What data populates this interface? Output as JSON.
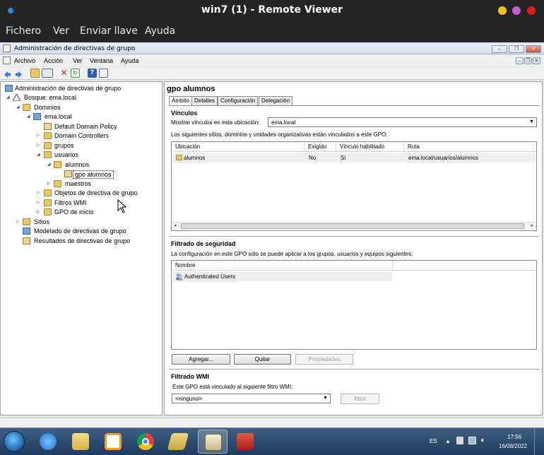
{
  "remote_viewer": {
    "title": "win7 (1) - Remote Viewer",
    "menu": [
      "Fichero",
      "Ver",
      "Enviar llave",
      "Ayuda"
    ],
    "window_controls": {
      "yellow": "#f5c211",
      "purple": "#c061cb",
      "red": "#e01b24"
    }
  },
  "gpmc": {
    "title": "Administración de directivas de grupo",
    "menu": [
      "Archivo",
      "Acción",
      "Ver",
      "Ventana",
      "Ayuda"
    ],
    "toolbar_icons": [
      "back-icon",
      "forward-icon",
      "folder-up-icon",
      "show-hide-tree-icon",
      "delete-icon",
      "refresh-icon",
      "help-icon",
      "properties-icon"
    ],
    "tree": {
      "root": "Administración de directivas de grupo",
      "forest": "Bosque: ema.local",
      "domains": "Dominios",
      "domain": "ema.local",
      "default_policy": "Default Domain Policy",
      "domain_controllers": "Domain Controllers",
      "grupos": "grupos",
      "usuarios": "usuarios",
      "alumnos": "alumnos",
      "gpo_alumnos": "gpo alumnos",
      "maestros": "maestros",
      "gpo_objects": "Objetos de directiva de grupo",
      "wmi_filters": "Filtros WMI",
      "starter_gpo": "GPO de inicio",
      "sites": "Sitios",
      "modeling": "Modelado de directivas de grupo",
      "results": "Resultados de directivas de grupo"
    },
    "detail": {
      "title": "gpo alumnos",
      "tabs": [
        "Ámbito",
        "Detalles",
        "Configuración",
        "Delegación"
      ],
      "links": {
        "heading": "Vínculos",
        "location_label": "Mostrar vínculos en esta ubicación:",
        "location_value": "ema.local",
        "description": "Los siguientes sitios, dominios y unidades organizativas están vinculados a este GPO:",
        "columns": [
          "Ubicación",
          "Exigido",
          "Vínculo habilitado",
          "Ruta"
        ],
        "rows": [
          {
            "location": "alumnos",
            "enforced": "No",
            "enabled": "Sí",
            "path": "ema.local/usuarios/alumnos"
          }
        ]
      },
      "security": {
        "heading": "Filtrado de seguridad",
        "description": "La configuración en este GPO sólo se puede aplicar a los grupos, usuarios y equipos siguientes:",
        "column": "Nombre",
        "rows": [
          "Authenticated Users"
        ],
        "buttons": {
          "add": "Agregar...",
          "remove": "Quitar",
          "properties": "Propiedades"
        }
      },
      "wmi": {
        "heading": "Filtrado WMI",
        "description": "Este GPO está vinculado al siguiente filtro WMI:",
        "value": "<ninguno>",
        "open_button": "Abrir"
      }
    }
  },
  "taskbar": {
    "apps": [
      "ie-icon",
      "explorer-icon",
      "media-player-icon",
      "chrome-icon",
      "scanner-icon",
      "gpmc-icon",
      "toolbox-icon"
    ],
    "language": "ES",
    "time": "17:56",
    "date": "16/08/2022"
  }
}
